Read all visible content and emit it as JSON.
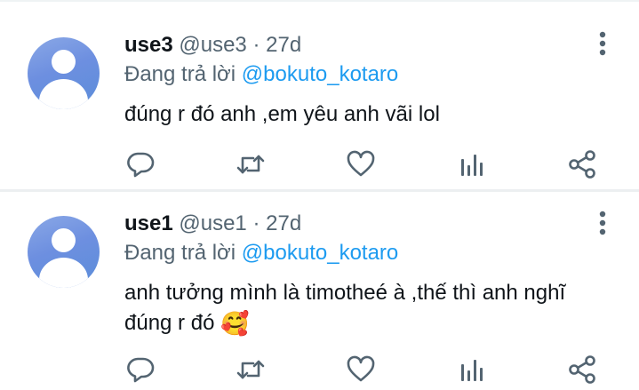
{
  "colors": {
    "link": "#1d9bf0",
    "name": "#0f1419",
    "secondary": "#536471",
    "avatar": "#6d8fe0",
    "divider": "#eceff1"
  },
  "icons": [
    "default-avatar-icon",
    "more-vertical-icon",
    "reply-icon",
    "retweet-icon",
    "like-icon",
    "views-icon",
    "share-icon"
  ],
  "tweets": [
    {
      "display_name": "use3",
      "handle": "@use3",
      "separator": "·",
      "time": "27d",
      "reply_prefix": "Đang trả lời",
      "reply_to": "@bokuto_kotaro",
      "text": "đúng r đó anh ,em yêu anh vãi lol",
      "emoji": ""
    },
    {
      "display_name": "use1",
      "handle": "@use1",
      "separator": "·",
      "time": "27d",
      "reply_prefix": "Đang trả lời",
      "reply_to": "@bokuto_kotaro",
      "text": "anh tưởng mình là timotheé à ,thế thì anh nghĩ đúng r đó",
      "emoji": "🥰"
    }
  ]
}
